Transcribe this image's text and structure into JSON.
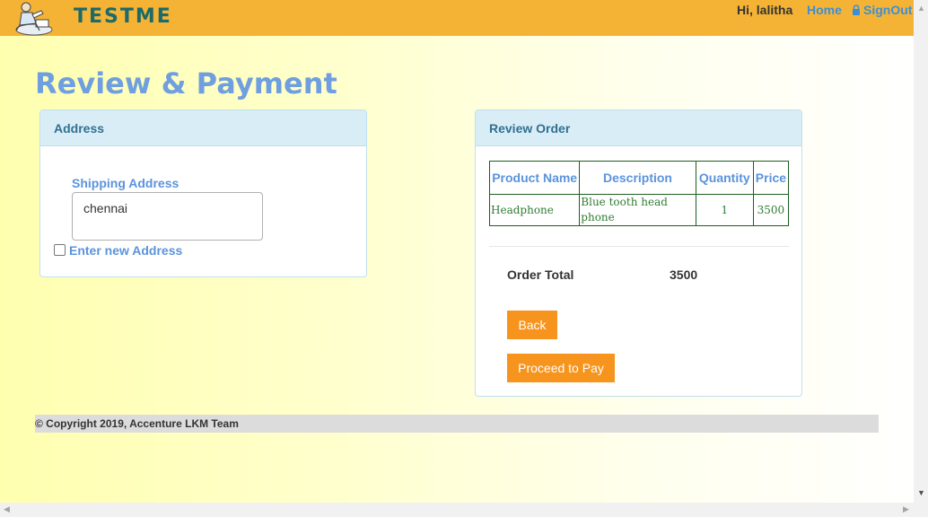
{
  "header": {
    "brand": "TESTME",
    "greeting": "Hi, lalitha",
    "home_label": "Home",
    "signout_label": "SignOut"
  },
  "page_title": "Review & Payment",
  "address_panel": {
    "title": "Address",
    "shipping_label": "Shipping Address",
    "shipping_value": "chennai",
    "new_address_label": "Enter new Address",
    "new_address_checked": false
  },
  "review_panel": {
    "title": "Review Order",
    "columns": [
      "Product Name",
      "Description",
      "Quantity",
      "Price"
    ],
    "rows": [
      {
        "product": "Headphone",
        "description": "Blue tooth head phone",
        "quantity": "1",
        "price": "3500"
      }
    ],
    "total_label": "Order Total",
    "total_value": "3500",
    "back_label": "Back",
    "pay_label": "Proceed to Pay"
  },
  "footer": {
    "copyright": "© Copyright 2019, Accenture LKM Team"
  },
  "colors": {
    "topbar": "#f5b335",
    "brand_text": "#1c6a6a",
    "link": "#3b8fd9",
    "title": "#6f9fe0",
    "button": "#f7941d",
    "panel_head": "#d9edf7"
  }
}
